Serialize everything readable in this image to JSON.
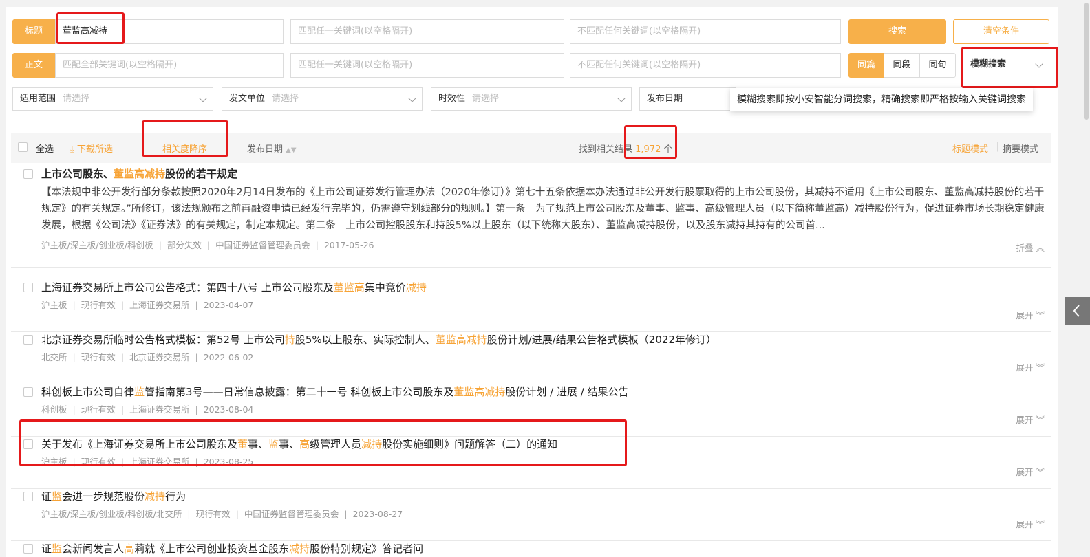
{
  "search": {
    "title_label": "标题",
    "title_value": "董监高减持",
    "title_any_placeholder": "匹配任一关键词(以空格隔开)",
    "title_none_placeholder": "不匹配任何关键词(以空格隔开)",
    "body_label": "正文",
    "body_all_placeholder": "匹配全部关键词(以空格隔开)",
    "body_any_placeholder": "匹配任一关键词(以空格隔开)",
    "body_none_placeholder": "不匹配任何关键词(以空格隔开)",
    "search_button": "搜索",
    "clear_button": "清空条件",
    "scope_options": [
      "同篇",
      "同段",
      "同句"
    ],
    "mode_select": "模糊搜索"
  },
  "filters": {
    "scope_label": "适用范围",
    "scope_placeholder": "请选择",
    "issuer_label": "发文单位",
    "issuer_placeholder": "请选择",
    "validity_label": "时效性",
    "validity_placeholder": "请选择",
    "date_label": "发布日期"
  },
  "tooltip": "模糊搜索即按小安智能分词搜索，精确搜索即严格按输入关键词搜索",
  "toolbar": {
    "select_all": "全选",
    "download": "下载所选",
    "sort_relevance": "相关度降序",
    "sort_date": "发布日期",
    "result_prefix": "找到相关结果",
    "result_count": "1,972",
    "result_suffix": "个",
    "mode_title": "标题模式",
    "mode_summary": "摘要模式"
  },
  "results": [
    {
      "title_parts": [
        "上市公司股东、",
        "董监高减持",
        "股份的若干规定"
      ],
      "abstract": "【本法规中非公开发行部分条款按照2020年2月14日发布的《上市公司证券发行管理办法（2020年修订）》第七十五条依据本办法通过非公开发行股票取得的上市公司股份，其减持不适用《上市公司股东、董监高减持股份的若干规定》的有关规定。”所修订，该法规颁布之前再融资申请已经发行完毕的，仍需遵守划线部分的规则。】第一条　为了规范上市公司股东及董事、监事、高级管理人员（以下简称董监高）减持股份行为，促进证券市场长期稳定健康发展，根据《公司法》《证券法》的有关规定，制定本规定。第二条　上市公司控股股东和持股5%以上股东（以下统称大股东）、董监高减持股份，以及股东减持其持有的公司首...",
      "meta": [
        "沪主板/深主板/创业板/科创板",
        "部分失效",
        "中国证券监督管理委员会",
        "2017-05-26"
      ],
      "toggle": "折叠"
    },
    {
      "title_parts": [
        "上海证券交易所上市公司公告格式：第四十八号 上市公司股东及",
        "董监高",
        "集中竞价",
        "减持"
      ],
      "meta": [
        "沪主板",
        "现行有效",
        "上海证券交易所",
        "2023-04-07"
      ],
      "toggle": "展开"
    },
    {
      "title_parts": [
        "北京证券交易所临时公告格式模板：第52号 上市公司",
        "持",
        "股5%以上股东、实际控制人、",
        "董监高减持",
        "股份计划/进展/结果公告格式模板（2022年修订）"
      ],
      "meta": [
        "北交所",
        "现行有效",
        "北京证券交易所",
        "2022-06-02"
      ],
      "toggle": "展开"
    },
    {
      "title_parts": [
        "科创板上市公司自律",
        "监",
        "管指南第3号——日常信息披露：第二十一号 科创板上市公司股东及",
        "董监高减持",
        "股份计划 / 进展 / 结果公告"
      ],
      "meta": [
        "科创板",
        "现行有效",
        "上海证券交易所",
        "2023-08-04"
      ],
      "toggle": "展开"
    },
    {
      "title_parts": [
        "关于发布《上海证券交易所上市公司股东及",
        "董",
        "事、",
        "监",
        "事、",
        "高",
        "级管理人员",
        "减持",
        "股份实施细则》问题解答（二）的通知"
      ],
      "meta": [
        "沪主板",
        "现行有效",
        "上海证券交易所",
        "2023-08-25"
      ],
      "toggle": "展开"
    },
    {
      "title_parts": [
        "证",
        "监",
        "会进一步规范股份",
        "减持",
        "行为"
      ],
      "meta": [
        "沪主板/深主板/创业板/科创板/北交所",
        "现行有效",
        "中国证券监督管理委员会",
        "2023-08-27"
      ],
      "toggle": "展开"
    },
    {
      "title_parts": [
        "证",
        "监",
        "会新闻发言人",
        "高",
        "莉就《上市公司创业投资基金股东",
        "减持",
        "股份特别规定》答记者问"
      ],
      "meta": [],
      "toggle": ""
    }
  ],
  "colors": {
    "accent": "#f7b04a",
    "highlight": "#f7a335",
    "annotation": "#e5191b"
  }
}
